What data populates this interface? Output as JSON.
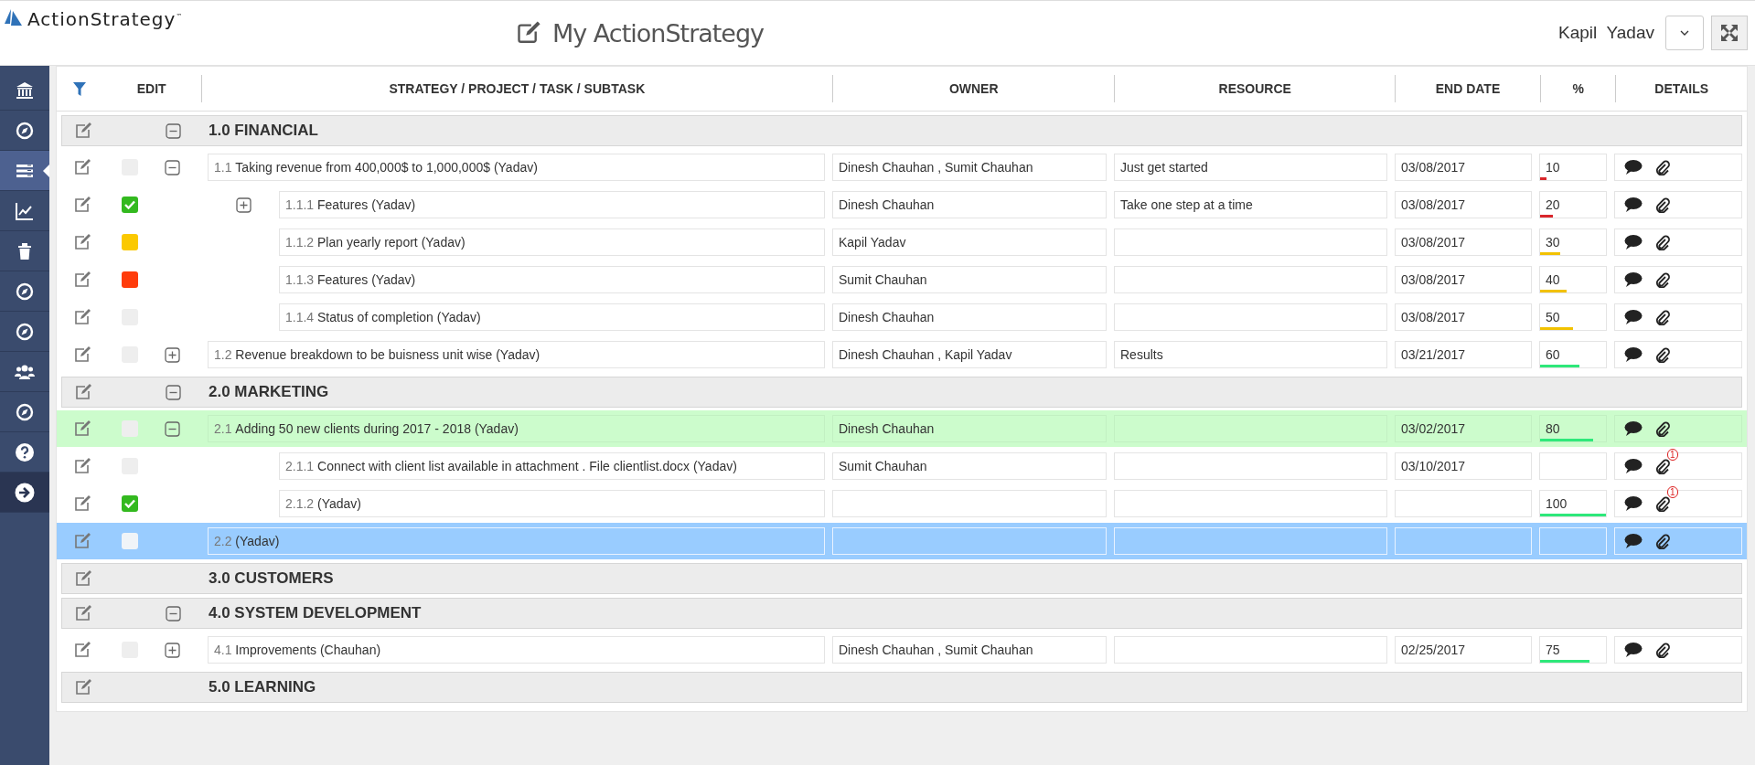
{
  "header": {
    "logo": "ActionStrategy",
    "trademark": "™",
    "title": "My ActionStrategy",
    "user": "Kapil  Yadav"
  },
  "sidebar": {
    "items": [
      {
        "kind": "bank",
        "selected": false
      },
      {
        "kind": "compass",
        "selected": false
      },
      {
        "kind": "list",
        "selected": true
      },
      {
        "kind": "chart",
        "selected": false
      },
      {
        "kind": "trash",
        "selected": false
      },
      {
        "kind": "compass",
        "selected": false
      },
      {
        "kind": "compass",
        "selected": false
      },
      {
        "kind": "users",
        "selected": false
      },
      {
        "kind": "compass",
        "selected": false
      },
      {
        "kind": "help",
        "selected": false
      },
      {
        "kind": "next",
        "selected": false
      }
    ]
  },
  "table": {
    "columns": [
      "EDIT",
      "STRATEGY / PROJECT / TASK / SUBTASK",
      "OWNER",
      "RESOURCE",
      "END DATE",
      "%",
      "DETAILS"
    ],
    "groups": [
      {
        "title": "1.0 FINANCIAL",
        "expanded": true,
        "children": [
          {
            "number": "1.1",
            "title": "Taking revenue from 400,000$ to 1,000,000$ (Yadav)",
            "owner": "Dinesh Chauhan , Sumit Chauhan",
            "resource": "Just get started",
            "end_date": "03/08/2017",
            "percent": "10",
            "level": 0.1,
            "checked": false,
            "expanded": true,
            "selected": false,
            "highlighted": false,
            "children": [
              {
                "number": "1.1.1",
                "title": "Features (Yadav)",
                "owner": "Dinesh Chauhan",
                "resource": "Take one step at a time",
                "end_date": "03/08/2017",
                "percent": "20",
                "level": 0.2,
                "checked": true,
                "expanded": false,
                "selected": false,
                "highlighted": false
              },
              {
                "number": "1.1.2",
                "title": "Plan yearly report (Yadav)",
                "owner": "Kapil Yadav",
                "end_date": "03/08/2017",
                "percent": "30",
                "level": 0.3,
                "checked": false,
                "color": "#fbc900",
                "selected": false,
                "highlighted": false
              },
              {
                "number": "1.1.3",
                "title": "Features (Yadav)",
                "owner": "Sumit Chauhan",
                "end_date": "03/08/2017",
                "percent": "40",
                "level": 0.4,
                "checked": false,
                "color": "#ff3c0b",
                "selected": false,
                "highlighted": false
              },
              {
                "number": "1.1.4",
                "title": "Status of completion (Yadav)",
                "owner": "Dinesh Chauhan",
                "end_date": "03/08/2017",
                "percent": "50",
                "level": 0.5,
                "checked": false,
                "selected": false,
                "highlighted": false
              }
            ]
          },
          {
            "number": "1.2",
            "title": "Revenue breakdown to be buisness unit wise (Yadav)",
            "owner": "Dinesh Chauhan , Kapil Yadav",
            "resource": "Results",
            "end_date": "03/21/2017",
            "percent": "60",
            "level": 0.6,
            "checked": false,
            "expanded": false,
            "selected": false,
            "highlighted": false
          }
        ]
      },
      {
        "title": "2.0 MARKETING",
        "expanded": true,
        "children": [
          {
            "number": "2.1",
            "title": "Adding 50 new clients during 2017 - 2018 (Yadav)",
            "owner": "Dinesh Chauhan",
            "end_date": "03/02/2017",
            "percent": "80",
            "level": 0.8,
            "checked": false,
            "expanded": true,
            "selected": false,
            "highlighted": true,
            "children": [
              {
                "number": "2.1.1",
                "title": "Connect with client list available in attachment . File clientlist.docx (Yadav)",
                "owner": "Sumit Chauhan",
                "end_date": "03/10/2017",
                "checked": false,
                "attachments": "1",
                "selected": false,
                "highlighted": false
              },
              {
                "number": "2.1.2",
                "title": "(Yadav)",
                "percent": "100",
                "level": 1,
                "checked": true,
                "attachments": "1",
                "selected": false,
                "highlighted": false
              }
            ]
          },
          {
            "number": "2.2",
            "title": "(Yadav)",
            "checked": false,
            "selected": true,
            "highlighted": false
          }
        ]
      },
      {
        "title": "3.0 CUSTOMERS"
      },
      {
        "title": "4.0 SYSTEM DEVELOPMENT",
        "expanded": true,
        "children": [
          {
            "number": "4.1",
            "title": "Improvements (Chauhan)",
            "owner": "Dinesh Chauhan , Sumit Chauhan",
            "end_date": "02/25/2017",
            "percent": "75",
            "level": 0.75,
            "checked": false,
            "expanded": false,
            "selected": false,
            "highlighted": false
          }
        ]
      },
      {
        "title": "5.0 LEARNING"
      }
    ]
  }
}
